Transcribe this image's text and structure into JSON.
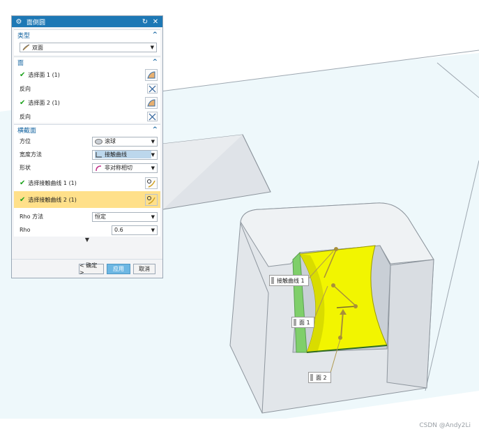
{
  "dialog": {
    "title": "面倒圆",
    "type_section": {
      "header": "类型",
      "type_value": "双面"
    },
    "face_section": {
      "header": "面",
      "select_face1": "选择面 1 (1)",
      "reverse1": "反向",
      "select_face2": "选择面 2 (1)",
      "reverse2": "反向"
    },
    "cross_section": {
      "header": "横截面",
      "orientation_label": "方位",
      "orientation_value": "滚球",
      "width_method_label": "宽度方法",
      "width_method_value": "接触曲线",
      "shape_label": "形状",
      "shape_value": "非对称相切",
      "contact_curve1": "选择接触曲线 1 (1)",
      "contact_curve2": "选择接触曲线 2 (1)",
      "rho_method_label": "Rho 方法",
      "rho_method_value": "恒定",
      "rho_label": "Rho",
      "rho_value": "0.6"
    },
    "buttons": {
      "ok": "< 确定 >",
      "apply": "应用",
      "cancel": "取消"
    }
  },
  "viewport": {
    "callouts": {
      "contact_curve1": "接触曲线 1",
      "face1": "面 1",
      "face2": "面 2"
    }
  },
  "watermark": "CSDN @Andy2Li",
  "colors": {
    "title_bar": "#1d78b5",
    "highlight_row": "#ffe08a",
    "fillet_face": "#f2f500",
    "model_gray": "#dfe3e8"
  },
  "icons": {
    "title": "gear-icon",
    "collapse": "chevron-up-icon",
    "face_select": "face-select-icon",
    "reverse": "reverse-direction-icon",
    "curve_select": "curve-select-icon"
  }
}
